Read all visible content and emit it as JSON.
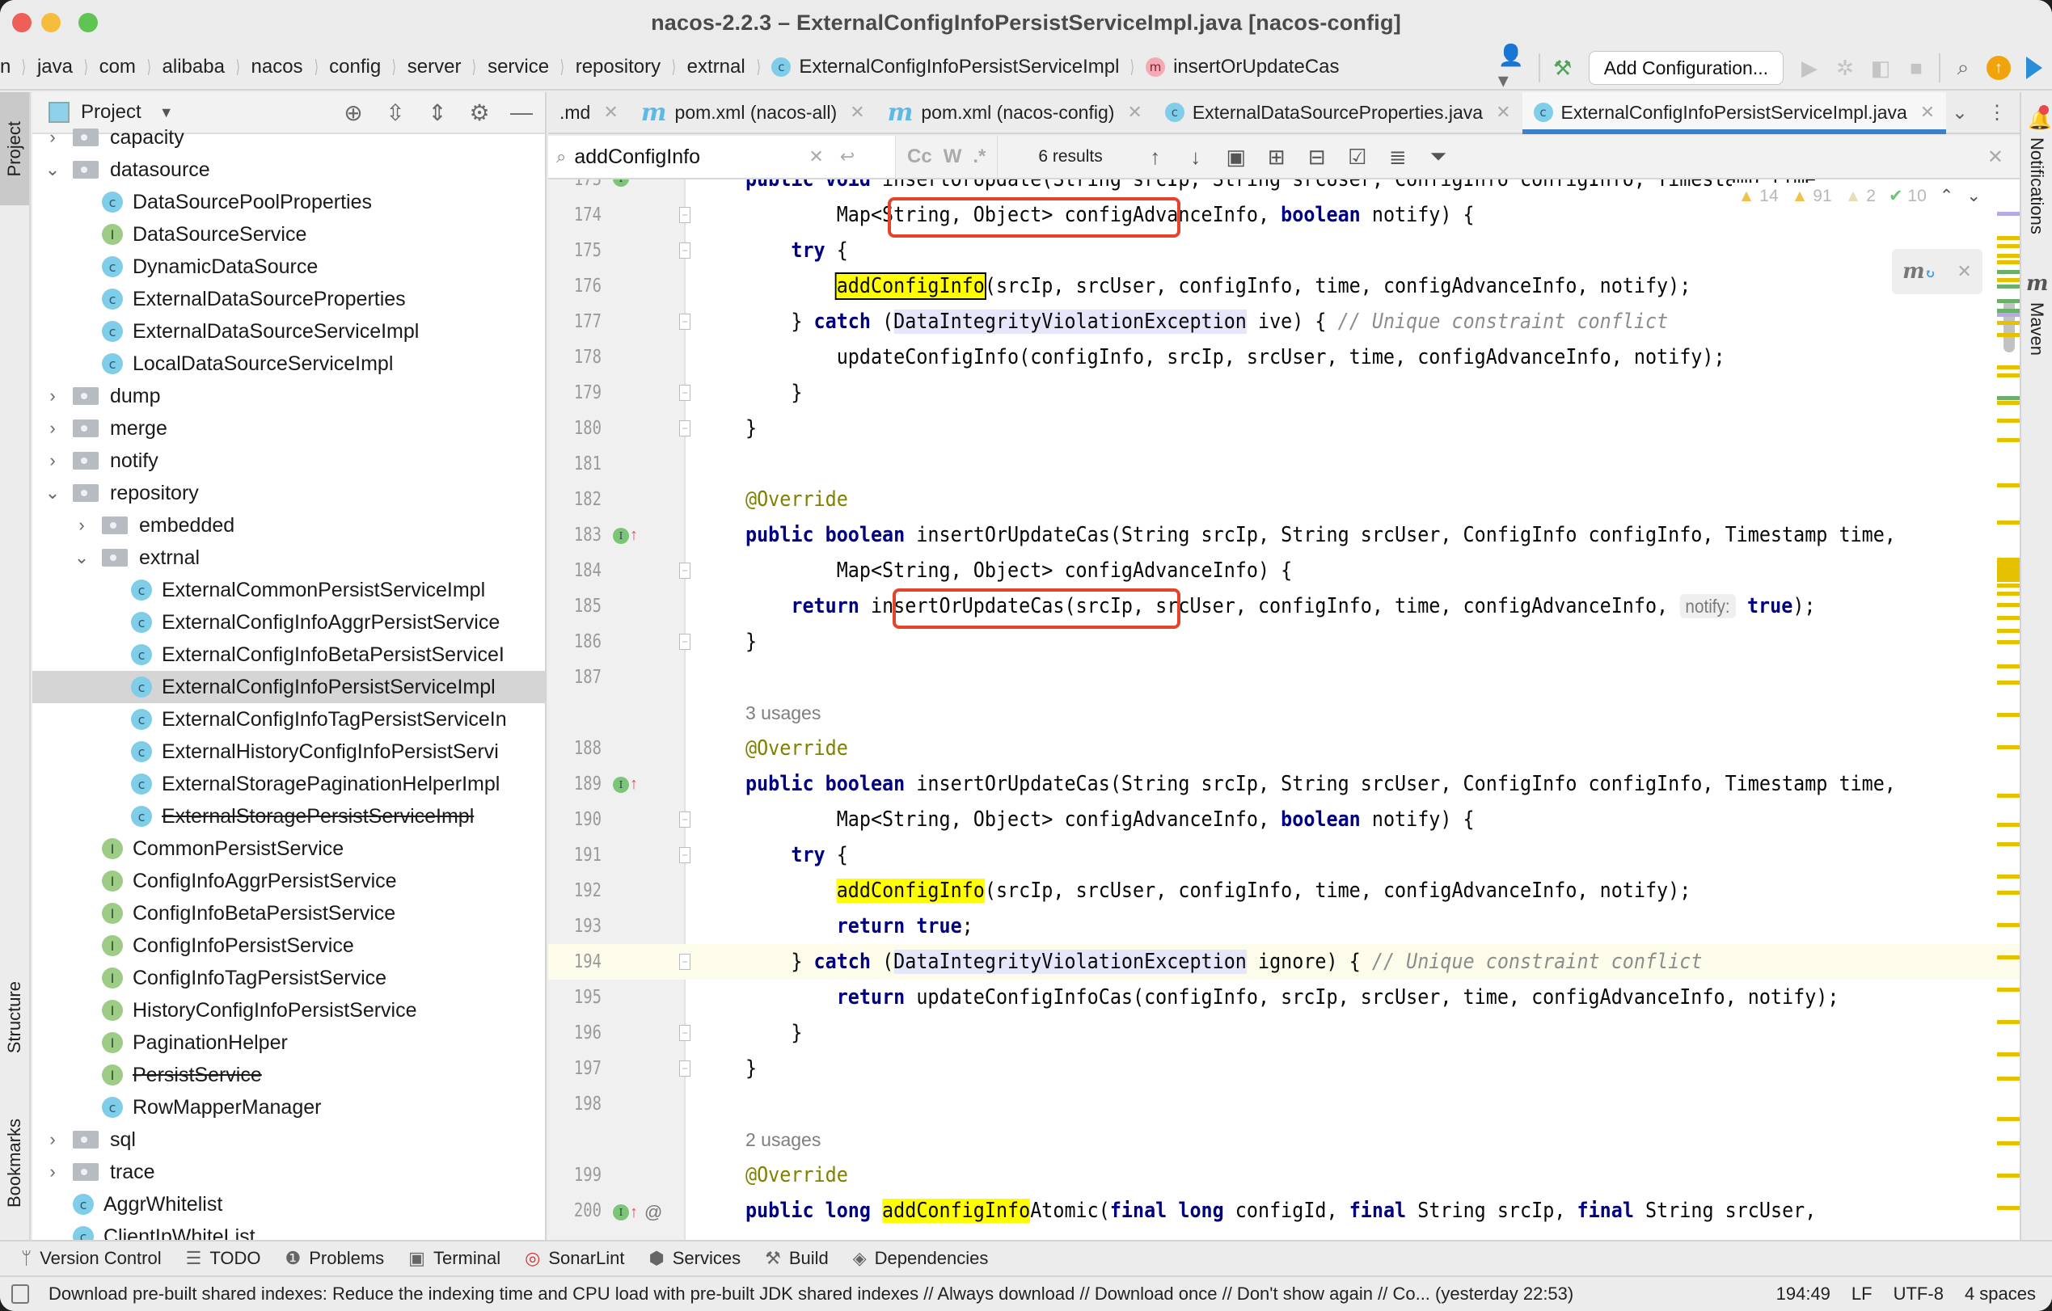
{
  "window": {
    "title": "nacos-2.2.3 – ExternalConfigInfoPersistServiceImpl.java [nacos-config]"
  },
  "breadcrumb": [
    {
      "label": "n",
      "badge": ""
    },
    {
      "label": "java",
      "badge": ""
    },
    {
      "label": "com",
      "badge": ""
    },
    {
      "label": "alibaba",
      "badge": ""
    },
    {
      "label": "nacos",
      "badge": ""
    },
    {
      "label": "config",
      "badge": ""
    },
    {
      "label": "server",
      "badge": ""
    },
    {
      "label": "service",
      "badge": ""
    },
    {
      "label": "repository",
      "badge": ""
    },
    {
      "label": "extrnal",
      "badge": ""
    },
    {
      "label": "ExternalConfigInfoPersistServiceImpl",
      "badge": "C"
    },
    {
      "label": "insertOrUpdateCas",
      "badge": "m"
    }
  ],
  "nav_tools": {
    "add_configuration_label": "Add Configuration...",
    "icons": [
      "user-vcs-icon",
      "build-hammer-icon",
      "run-icon",
      "debug-icon",
      "coverage-icon",
      "stop-icon",
      "search-icon",
      "update-icon",
      "toolbox-icon"
    ]
  },
  "left_stripe": {
    "project_label": "Project",
    "structure_label": "Structure",
    "bookmarks_label": "Bookmarks"
  },
  "project_panel": {
    "title": "Project",
    "tree": [
      {
        "label": "capacity",
        "type": "folder",
        "depth": 0,
        "expanded": false
      },
      {
        "label": "datasource",
        "type": "folder",
        "depth": 0,
        "expanded": true
      },
      {
        "label": "DataSourcePoolProperties",
        "type": "class",
        "depth": 1
      },
      {
        "label": "DataSourceService",
        "type": "interface",
        "depth": 1
      },
      {
        "label": "DynamicDataSource",
        "type": "class",
        "depth": 1
      },
      {
        "label": "ExternalDataSourceProperties",
        "type": "class",
        "depth": 1
      },
      {
        "label": "ExternalDataSourceServiceImpl",
        "type": "class",
        "depth": 1
      },
      {
        "label": "LocalDataSourceServiceImpl",
        "type": "class",
        "depth": 1
      },
      {
        "label": "dump",
        "type": "folder",
        "depth": 0,
        "expanded": false
      },
      {
        "label": "merge",
        "type": "folder",
        "depth": 0,
        "expanded": false
      },
      {
        "label": "notify",
        "type": "folder",
        "depth": 0,
        "expanded": false
      },
      {
        "label": "repository",
        "type": "folder",
        "depth": 0,
        "expanded": true
      },
      {
        "label": "embedded",
        "type": "folder",
        "depth": 1,
        "expanded": false
      },
      {
        "label": "extrnal",
        "type": "folder",
        "depth": 1,
        "expanded": true
      },
      {
        "label": "ExternalCommonPersistServiceImpl",
        "type": "class",
        "depth": 2
      },
      {
        "label": "ExternalConfigInfoAggrPersistService",
        "type": "class",
        "depth": 2
      },
      {
        "label": "ExternalConfigInfoBetaPersistServiceI",
        "type": "class",
        "depth": 2
      },
      {
        "label": "ExternalConfigInfoPersistServiceImpl",
        "type": "class",
        "depth": 2,
        "selected": true
      },
      {
        "label": "ExternalConfigInfoTagPersistServiceIn",
        "type": "class",
        "depth": 2
      },
      {
        "label": "ExternalHistoryConfigInfoPersistServi",
        "type": "class",
        "depth": 2
      },
      {
        "label": "ExternalStoragePaginationHelperImpl",
        "type": "class",
        "depth": 2
      },
      {
        "label": "ExternalStoragePersistServiceImpl",
        "type": "class",
        "depth": 2,
        "deprecated": true
      },
      {
        "label": "CommonPersistService",
        "type": "interface",
        "depth": 1
      },
      {
        "label": "ConfigInfoAggrPersistService",
        "type": "interface",
        "depth": 1
      },
      {
        "label": "ConfigInfoBetaPersistService",
        "type": "interface",
        "depth": 1
      },
      {
        "label": "ConfigInfoPersistService",
        "type": "interface",
        "depth": 1
      },
      {
        "label": "ConfigInfoTagPersistService",
        "type": "interface",
        "depth": 1
      },
      {
        "label": "HistoryConfigInfoPersistService",
        "type": "interface",
        "depth": 1
      },
      {
        "label": "PaginationHelper",
        "type": "interface",
        "depth": 1
      },
      {
        "label": "PersistService",
        "type": "interface",
        "depth": 1,
        "deprecated": true
      },
      {
        "label": "RowMapperManager",
        "type": "class",
        "depth": 1
      },
      {
        "label": "sql",
        "type": "folder",
        "depth": 0,
        "expanded": false
      },
      {
        "label": "trace",
        "type": "folder",
        "depth": 0,
        "expanded": false
      },
      {
        "label": "AggrWhitelist",
        "type": "class",
        "depth": 0,
        "leaf": true
      },
      {
        "label": "ClientIpWhiteList",
        "type": "class",
        "depth": 0,
        "leaf": true
      }
    ]
  },
  "tabs": [
    {
      "label": ".md",
      "icon": "none",
      "active": false
    },
    {
      "label": "pom.xml (nacos-all)",
      "icon": "maven",
      "active": false
    },
    {
      "label": "pom.xml (nacos-config)",
      "icon": "maven",
      "active": false
    },
    {
      "label": "ExternalDataSourceProperties.java",
      "icon": "class",
      "active": false
    },
    {
      "label": "ExternalConfigInfoPersistServiceImpl.java",
      "icon": "class",
      "active": true
    }
  ],
  "find": {
    "query": "addConfigInfo",
    "results": "6 results",
    "options": [
      "Cc",
      "W",
      ".*"
    ]
  },
  "inspections": {
    "warnings": "14",
    "weak_warnings": "91",
    "typos": "2",
    "ok": "10"
  },
  "editor": {
    "lines": [
      {
        "n": "173",
        "marker": "impl",
        "html": "<span class='kw'>public void</span> insertOrUpdate(String srcIp, String srcUser, ConfigInfo configInfo, Timestamp time,"
      },
      {
        "n": "174",
        "fold": true,
        "html": "        Map&lt;String, Object&gt; configAdvanceInfo, <span class='kw'>boolean</span> notify) {"
      },
      {
        "n": "175",
        "fold": true,
        "html": "    <span class='kw'>try</span> {"
      },
      {
        "n": "176",
        "html": "        <span class='hl hl-border'>addConfigInfo</span>(srcIp, srcUser, configInfo, time, configAdvanceInfo, notify);"
      },
      {
        "n": "177",
        "fold": true,
        "html": "    } <span class='kw'>catch</span> (<span class='type-hl'>DataIntegrityViolationException</span> ive) { <span class='cmt'>// Unique constraint conflict</span>"
      },
      {
        "n": "178",
        "html": "        updateConfigInfo(configInfo, srcIp, srcUser, time, configAdvanceInfo, notify);"
      },
      {
        "n": "179",
        "fold": true,
        "html": "    }"
      },
      {
        "n": "180",
        "fold": true,
        "html": "}"
      },
      {
        "n": "181",
        "html": ""
      },
      {
        "n": "182",
        "html": "<span class='ann'>@Override</span>"
      },
      {
        "n": "183",
        "marker": "impl-up",
        "html": "<span class='kw'>public boolean</span> insertOrUpdateCas(String srcIp, String srcUser, ConfigInfo configInfo, Timestamp time,"
      },
      {
        "n": "184",
        "fold": true,
        "html": "        Map&lt;String, Object&gt; configAdvanceInfo) {"
      },
      {
        "n": "185",
        "html": "    <span class='kw'>return</span> insertOrUpdateCas(srcIp, srcUser, configInfo, time, configAdvanceInfo, <span class='hint'>notify:</span> <span class='kw'>true</span>);"
      },
      {
        "n": "186",
        "fold": true,
        "html": "}"
      },
      {
        "n": "187",
        "html": ""
      },
      {
        "usages": "3 usages"
      },
      {
        "n": "188",
        "html": "<span class='ann'>@Override</span>"
      },
      {
        "n": "189",
        "marker": "impl-up",
        "html": "<span class='kw'>public boolean</span> insertOrUpdateCas(String srcIp, String srcUser, ConfigInfo configInfo, Timestamp time,"
      },
      {
        "n": "190",
        "fold": true,
        "html": "        Map&lt;String, Object&gt; configAdvanceInfo, <span class='kw'>boolean</span> notify) {"
      },
      {
        "n": "191",
        "fold": true,
        "html": "    <span class='kw'>try</span> {"
      },
      {
        "n": "192",
        "html": "        <span class='hl'>addConfigInfo</span>(srcIp, srcUser, configInfo, time, configAdvanceInfo, notify);"
      },
      {
        "n": "193",
        "html": "        <span class='kw'>return true</span>;"
      },
      {
        "n": "194",
        "fold": true,
        "current": true,
        "html": "    } <span class='kw'>catch</span> (<span class='type-hl'>DataIntegrityViolationException</span> ignore) { <span class='cmt'>// Unique constraint conflict</span>"
      },
      {
        "n": "195",
        "html": "        <span class='kw'>return</span> updateConfigInfoCas(configInfo, srcIp, srcUser, time, configAdvanceInfo, notify);"
      },
      {
        "n": "196",
        "fold": true,
        "html": "    }"
      },
      {
        "n": "197",
        "fold": true,
        "html": "}"
      },
      {
        "n": "198",
        "html": ""
      },
      {
        "usages": "2 usages"
      },
      {
        "n": "199",
        "html": "<span class='ann'>@Override</span>"
      },
      {
        "n": "200",
        "marker": "impl-up-at",
        "html": "<span class='kw'>public long</span> <span class='hl'>addConfigInfo</span>Atomic(<span class='kw'>final long</span> configId, <span class='kw'>final</span> String srcIp, <span class='kw'>final</span> String srcUser,"
      }
    ]
  },
  "right_stripe": {
    "notifications_label": "Notifications",
    "maven_label": "Maven"
  },
  "bottom_tools": [
    {
      "label": "Version Control",
      "icon": "vcs-branch-icon",
      "glyph": "ᛘ"
    },
    {
      "label": "TODO",
      "icon": "todo-list-icon",
      "glyph": "☰"
    },
    {
      "label": "Problems",
      "icon": "problems-icon",
      "glyph": "❶"
    },
    {
      "label": "Terminal",
      "icon": "terminal-icon",
      "glyph": "▣"
    },
    {
      "label": "SonarLint",
      "icon": "sonarlint-icon",
      "glyph": "◎"
    },
    {
      "label": "Services",
      "icon": "services-icon",
      "glyph": "⬢"
    },
    {
      "label": "Build",
      "icon": "build-hammer-icon",
      "glyph": "⚒"
    },
    {
      "label": "Dependencies",
      "icon": "dependencies-icon",
      "glyph": "◈"
    }
  ],
  "status": {
    "message": "Download pre-built shared indexes: Reduce the indexing time and CPU load with pre-built JDK shared indexes // Always download // Download once // Don't show again // Co... (yesterday 22:53)",
    "caret": "194:49",
    "line_sep": "LF",
    "encoding": "UTF-8",
    "indent": "4 spaces"
  }
}
